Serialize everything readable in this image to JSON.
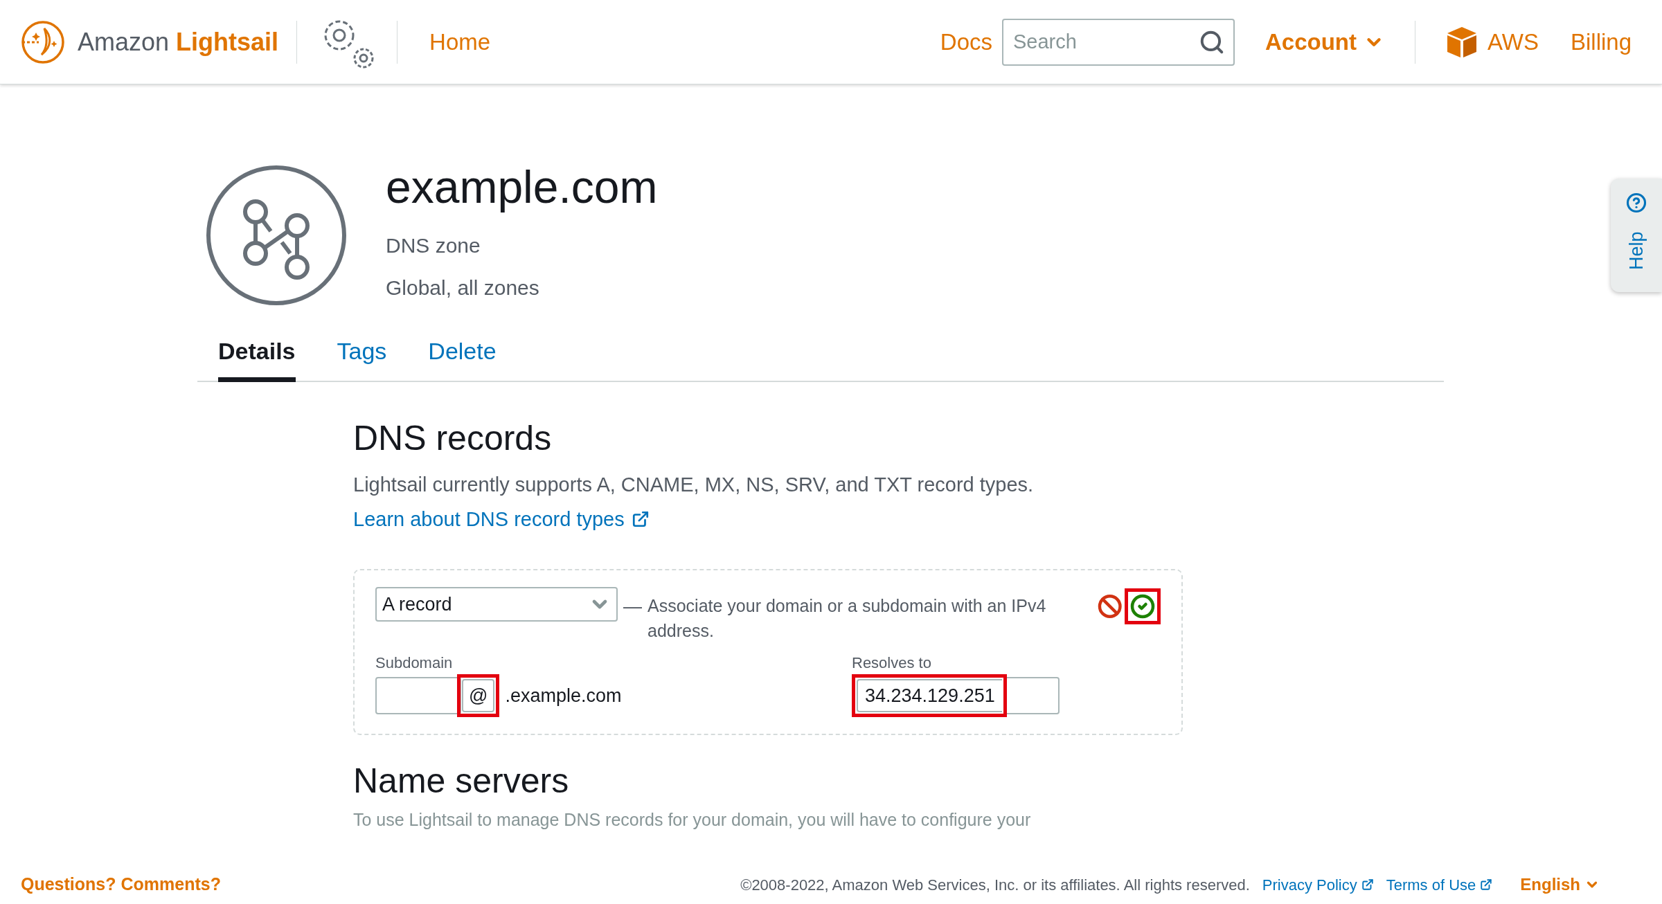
{
  "header": {
    "brand": {
      "prefix": "Amazon",
      "name": "Lightsail"
    },
    "nav": [
      "Home"
    ],
    "docs": "Docs",
    "search": {
      "placeholder": "Search"
    },
    "account": "Account",
    "aws": "AWS",
    "billing": "Billing"
  },
  "resource": {
    "title": "example.com",
    "type": "DNS zone",
    "location": "Global, all zones"
  },
  "tabs": [
    {
      "label": "Details",
      "selected": true
    },
    {
      "label": "Tags",
      "selected": false
    },
    {
      "label": "Delete",
      "selected": false
    }
  ],
  "dns_records": {
    "heading": "DNS records",
    "description": "Lightsail currently supports A, CNAME, MX, NS, SRV, and TXT record types.",
    "link": "Learn about DNS record types"
  },
  "record_editor": {
    "record_type": "A record",
    "dash": "—",
    "description": "Associate your domain or a subdomain with an IPv4 address.",
    "save_highlighted": true,
    "subdomain": {
      "label": "Subdomain",
      "suffix": "@",
      "domain": ".example.com",
      "highlighted": true
    },
    "resolves_to": {
      "label": "Resolves to",
      "value": "34.234.129.251",
      "highlighted": true
    }
  },
  "name_servers": {
    "heading": "Name servers",
    "text": "To use Lightsail to manage DNS records for your domain, you will have to configure your"
  },
  "help_tab": {
    "label": "Help"
  },
  "footer": {
    "feedback": "Questions? Comments?",
    "copyright": "©2008-2022, Amazon Web Services, Inc. or its affiliates. All rights reserved.",
    "links": [
      "Privacy Policy",
      "Terms of Use"
    ],
    "language": "English"
  }
}
